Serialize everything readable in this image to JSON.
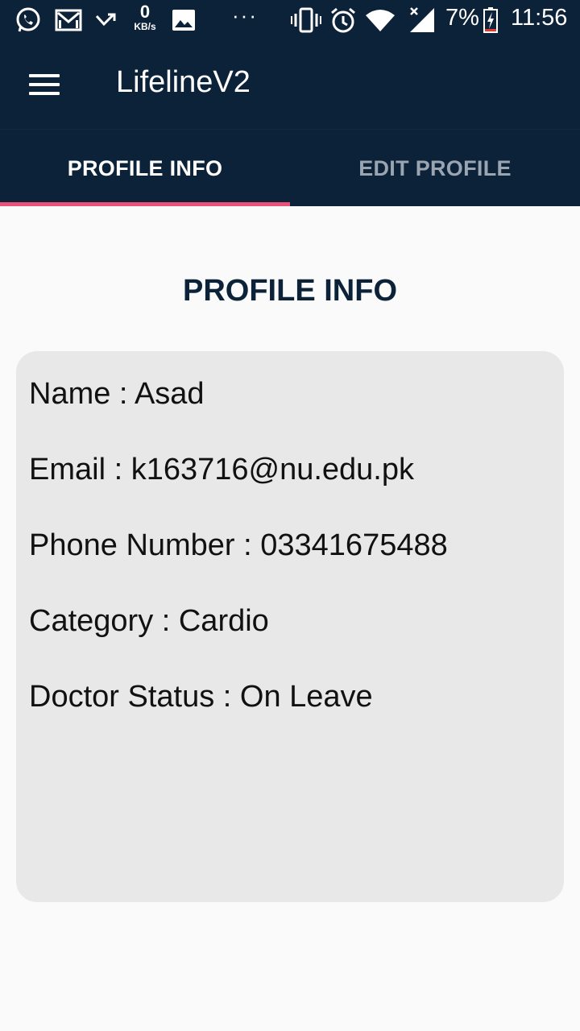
{
  "status_bar": {
    "data_speed_value": "0",
    "data_speed_unit": "KB/s",
    "overflow_dots": "···",
    "battery_percent": "7%",
    "time": "11:56",
    "icons": [
      "whatsapp-icon",
      "gmail-icon",
      "missed-call-icon",
      "data-speed-indicator",
      "gallery-icon",
      "more-notifications-icon",
      "vibrate-icon",
      "alarm-icon",
      "wifi-icon",
      "signal-icon",
      "battery-icon"
    ]
  },
  "app_bar": {
    "title": "LifelineV2",
    "menu_icon": "hamburger-menu-icon"
  },
  "tabs": [
    {
      "label": "PROFILE INFO",
      "active": true
    },
    {
      "label": "EDIT PROFILE",
      "active": false
    }
  ],
  "colors": {
    "primary": "#0b2239",
    "accent": "#e9517b",
    "card": "#e8e8e8",
    "background": "#fafafa"
  },
  "profile": {
    "heading": "PROFILE INFO",
    "fields": [
      {
        "text": "Name : Asad"
      },
      {
        "text": "Email : k163716@nu.edu.pk"
      },
      {
        "text": "Phone Number : 03341675488"
      },
      {
        "text": "Category : Cardio"
      },
      {
        "text": "Doctor Status : On Leave"
      }
    ]
  }
}
